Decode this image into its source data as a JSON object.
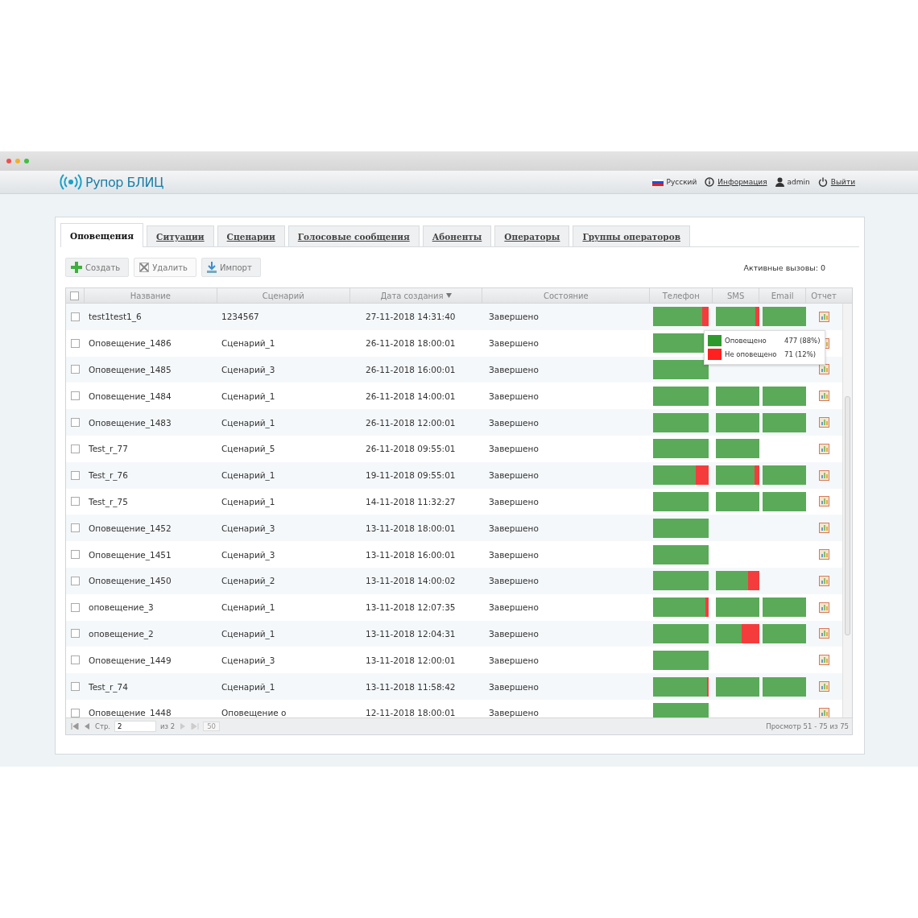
{
  "app": {
    "logo": "Рупор БЛИЦ",
    "language": "Русский",
    "info_link": "Информация",
    "user": "admin",
    "logout_link": "Выйти"
  },
  "tabs": [
    {
      "label": "Оповещения",
      "selected": true
    },
    {
      "label": "Ситуации",
      "selected": false
    },
    {
      "label": "Сценарии",
      "selected": false
    },
    {
      "label": "Голосовые сообщения",
      "selected": false
    },
    {
      "label": "Абоненты",
      "selected": false
    },
    {
      "label": "Операторы",
      "selected": false
    },
    {
      "label": "Группы операторов",
      "selected": false
    }
  ],
  "toolbar": {
    "buttons": [
      {
        "label": "Создать",
        "kind": "create"
      },
      {
        "label": "Удалить",
        "kind": "delete"
      },
      {
        "label": "Импорт",
        "kind": "import"
      }
    ],
    "active_calls": "Активные вызовы: 0"
  },
  "table": {
    "select_all_checked": false,
    "columns": [
      "Название",
      "Сценарий",
      "Дата создания",
      "Состояние",
      "Телефон",
      "SMS",
      "Email",
      "Отчет"
    ],
    "rows": [
      {
        "name": "test1test1_6",
        "scenario": "1234567",
        "date": "27-11-2018 14:31:40",
        "state": "Завершено",
        "checked": false,
        "phone": {
          "level": 0.88
        },
        "sms": {
          "level": 0.9
        },
        "email": {
          "level": 1
        }
      },
      {
        "name": "Оповещение_1486",
        "scenario": "Сценарий_1",
        "date": "26-11-2018 18:00:01",
        "state": "Завершено",
        "checked": false,
        "phone": {
          "level": 1
        }
      },
      {
        "name": "Оповещение_1485",
        "scenario": "Сценарий_3",
        "date": "26-11-2018 16:00:01",
        "state": "Завершено",
        "checked": false,
        "phone": {
          "level": 1
        }
      },
      {
        "name": "Оповещение_1484",
        "scenario": "Сценарий_1",
        "date": "26-11-2018 14:00:01",
        "state": "Завершено",
        "checked": false,
        "phone": {
          "level": 1
        },
        "sms": {
          "level": 1
        },
        "email": {
          "level": 1
        }
      },
      {
        "name": "Оповещение_1483",
        "scenario": "Сценарий_1",
        "date": "26-11-2018 12:00:01",
        "state": "Завершено",
        "checked": false,
        "phone": {
          "level": 1
        },
        "sms": {
          "level": 1
        },
        "email": {
          "level": 1
        }
      },
      {
        "name": "Test_r_77",
        "scenario": "Сценарий_5",
        "date": "26-11-2018 09:55:01",
        "state": "Завершено",
        "checked": false,
        "phone": {
          "level": 1
        },
        "sms": {
          "level": 1
        }
      },
      {
        "name": "Test_r_76",
        "scenario": "Сценарий_1",
        "date": "19-11-2018 09:55:01",
        "state": "Завершено",
        "checked": false,
        "phone": {
          "level": 0.77
        },
        "sms": {
          "level": 0.88
        },
        "email": {
          "level": 1
        }
      },
      {
        "name": "Test_r_75",
        "scenario": "Сценарий_1",
        "date": "14-11-2018 11:32:27",
        "state": "Завершено",
        "checked": false,
        "phone": {
          "level": 1
        },
        "sms": {
          "level": 1
        },
        "email": {
          "level": 1
        }
      },
      {
        "name": "Оповещение_1452",
        "scenario": "Сценарий_3",
        "date": "13-11-2018 18:00:01",
        "state": "Завершено",
        "checked": false,
        "phone": {
          "level": 1
        }
      },
      {
        "name": "Оповещение_1451",
        "scenario": "Сценарий_3",
        "date": "13-11-2018 16:00:01",
        "state": "Завершено",
        "checked": false,
        "phone": {
          "level": 1
        }
      },
      {
        "name": "Оповещение_1450",
        "scenario": "Сценарий_2",
        "date": "13-11-2018 14:00:02",
        "state": "Завершено",
        "checked": false,
        "phone": {
          "level": 1
        },
        "sms": {
          "level": 0.74
        }
      },
      {
        "name": "оповещение_3",
        "scenario": "Сценарий_1",
        "date": "13-11-2018 12:07:35",
        "state": "Завершено",
        "checked": false,
        "phone": {
          "level": 0.94
        },
        "sms": {
          "level": 1
        },
        "email": {
          "level": 1
        }
      },
      {
        "name": "оповещение_2",
        "scenario": "Сценарий_1",
        "date": "13-11-2018 12:04:31",
        "state": "Завершено",
        "checked": false,
        "phone": {
          "level": 1
        },
        "sms": {
          "level": 0.6
        },
        "email": {
          "level": 1
        }
      },
      {
        "name": "Оповещение_1449",
        "scenario": "Сценарий_3",
        "date": "13-11-2018 12:00:01",
        "state": "Завершено",
        "checked": false,
        "phone": {
          "level": 1
        }
      },
      {
        "name": "Test_r_74",
        "scenario": "Сценарий_1",
        "date": "13-11-2018 11:58:42",
        "state": "Завершено",
        "checked": false,
        "phone": {
          "level": 0.97
        },
        "sms": {
          "level": 1
        },
        "email": {
          "level": 1
        }
      },
      {
        "name": "Оповещение_1448",
        "scenario": "Оповещение о",
        "date": "12-11-2018 18:00:01",
        "state": "Завершено",
        "checked": false,
        "phone": {
          "level": 1
        }
      }
    ]
  },
  "tooltip": {
    "entries": [
      {
        "label": "Оповещено",
        "value": "477 (88%)",
        "color": "#2e9a2e"
      },
      {
        "label": "Не оповещено",
        "value": "71 (12%)",
        "color": "#ff2020"
      }
    ]
  },
  "pager": {
    "page_label": "Стр.",
    "page": "2",
    "of_pages": "из 2",
    "page_size": "50",
    "summary": "Просмотр 51 - 75 из 75"
  }
}
